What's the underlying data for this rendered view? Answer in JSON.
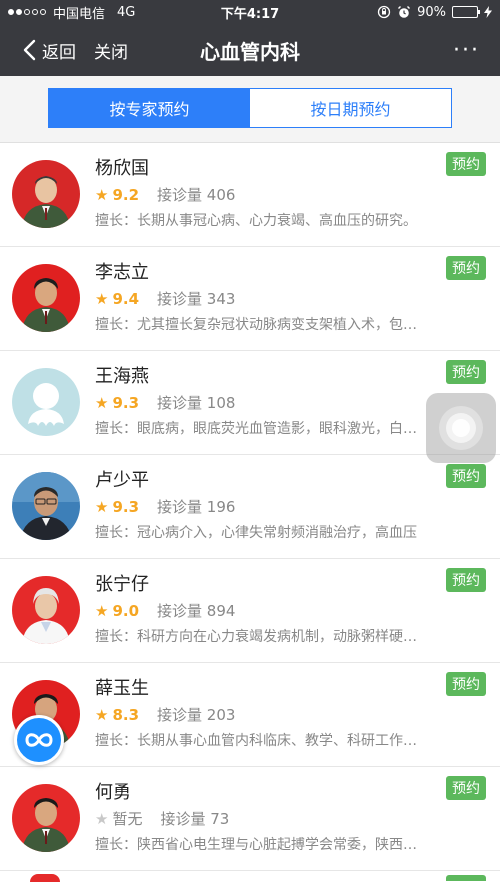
{
  "status_bar": {
    "carrier": "中国电信",
    "network": "4G",
    "time": "下午4:17",
    "battery": "90%",
    "battery_level": 0.9
  },
  "nav": {
    "back_label": "返回",
    "close_label": "关闭",
    "title": "心血管内科",
    "more": "···"
  },
  "tabs": [
    {
      "label": "按专家预约",
      "active": true
    },
    {
      "label": "按日期预约",
      "active": false
    }
  ],
  "colors": {
    "accent": "#2d7ff9",
    "book_button": "#5cb85c",
    "star": "#f5a623",
    "nav_bg": "#393a3f"
  },
  "doctors": [
    {
      "name": "杨欣国",
      "score": "9.2",
      "visits": "接诊量 406",
      "specialty": "擅长：长期从事冠心病、心力衰竭、高血压的研究。",
      "book_label": "预约",
      "avatar": "red-background-military-uniform"
    },
    {
      "name": "李志立",
      "score": "9.4",
      "visits": "接诊量 343",
      "specialty": "擅长：尤其擅长复杂冠状动脉病变支架植入术，包…",
      "book_label": "预约",
      "avatar": "red-background-military-uniform"
    },
    {
      "name": "王海燕",
      "score": "9.3",
      "visits": "接诊量 108",
      "specialty": "擅长：眼底病，眼底荧光血管造影，眼科激光，白…",
      "book_label": "预约",
      "avatar": "default-placeholder"
    },
    {
      "name": "卢少平",
      "score": "9.3",
      "visits": "接诊量 196",
      "specialty": "擅长：冠心病介入，心律失常射频消融治疗，高血压",
      "book_label": "预约",
      "avatar": "blue-background-suit"
    },
    {
      "name": "张宁仔",
      "score": "9.0",
      "visits": "接诊量 894",
      "specialty": "擅长：科研方向在心力衰竭发病机制，动脉粥样硬…",
      "book_label": "预约",
      "avatar": "red-background-white-coat"
    },
    {
      "name": "薛玉生",
      "score": "8.3",
      "visits": "接诊量 203",
      "specialty": "擅长：长期从事心血管内科临床、教学、科研工作…",
      "book_label": "预约",
      "avatar": "red-background-military-uniform"
    },
    {
      "name": "何勇",
      "score": "暂无",
      "visits": "接诊量 73",
      "specialty": "擅长：陕西省心电生理与心脏起搏学会常委，陕西…",
      "book_label": "预约",
      "avatar": "red-background-military-uniform",
      "unrated": true
    }
  ]
}
